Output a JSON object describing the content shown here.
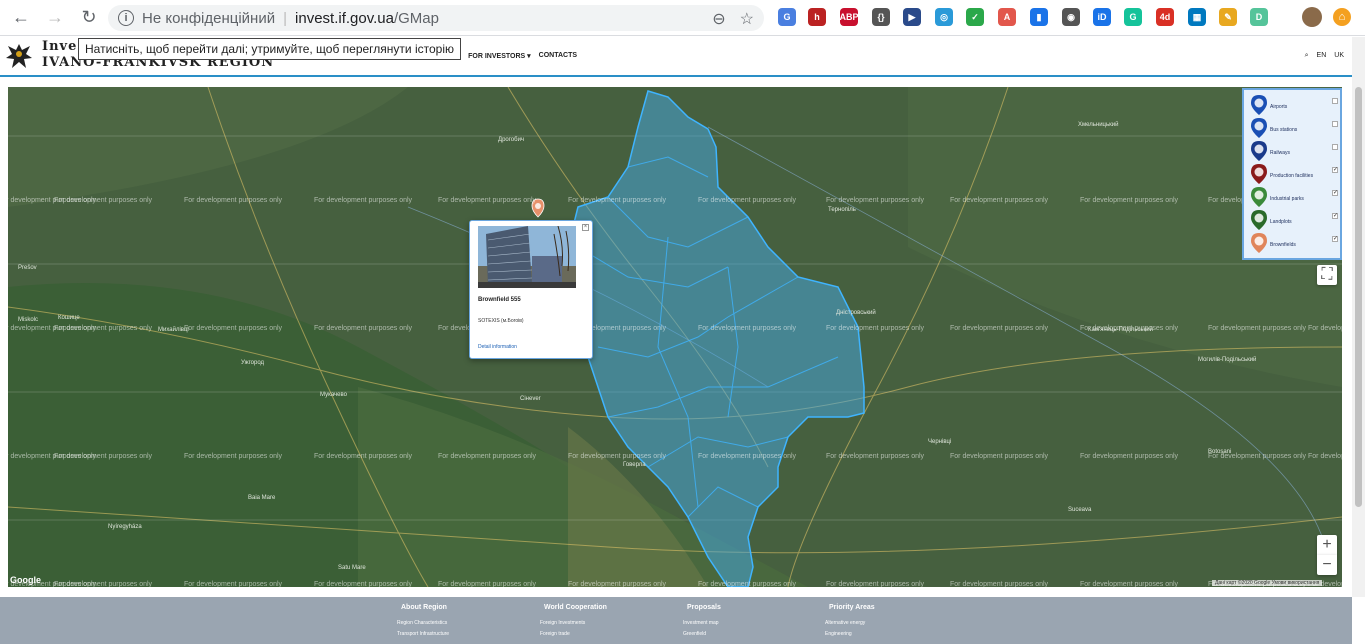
{
  "browser": {
    "security_label": "Не конфіденційний",
    "url_host": "invest.if.gov.ua",
    "url_path": "/GMap",
    "back_tooltip": "Натисніть, щоб перейти далі; утримуйте, щоб переглянути історію"
  },
  "extensions": [
    {
      "name": "translate-extension-icon",
      "text": "G",
      "color": "#4a7fe0"
    },
    {
      "name": "h-extension-icon",
      "text": "h",
      "color": "#b22"
    },
    {
      "name": "adblock-extension-icon",
      "text": "ABP",
      "color": "#c8102e"
    },
    {
      "name": "code-extension-icon",
      "text": "{}",
      "color": "#555"
    },
    {
      "name": "play-extension-icon",
      "text": "▶",
      "color": "#2a4a8a"
    },
    {
      "name": "compass-extension-icon",
      "text": "◎",
      "color": "#2a9ad8"
    },
    {
      "name": "shield-extension-icon",
      "text": "✓",
      "color": "#2ba84a"
    },
    {
      "name": "pdf-extension-icon",
      "text": "A",
      "color": "#e2574c"
    },
    {
      "name": "bookmark-extension-icon",
      "text": "▮",
      "color": "#1a73e8"
    },
    {
      "name": "lightbulb-extension-icon",
      "text": "◉",
      "color": "#555"
    },
    {
      "name": "id-extension-icon",
      "text": "iD",
      "color": "#1a73e8"
    },
    {
      "name": "grammarly-extension-icon",
      "text": "G",
      "color": "#15c39a"
    },
    {
      "name": "calendar-extension-icon",
      "text": "4d",
      "color": "#d93025"
    },
    {
      "name": "trello-extension-icon",
      "text": "▦",
      "color": "#0079bf"
    },
    {
      "name": "pencil-extension-icon",
      "text": "✎",
      "color": "#e8a820"
    },
    {
      "name": "d-extension-icon",
      "text": "D",
      "color": "#55c49a"
    }
  ],
  "site": {
    "title_line1": "Inves",
    "title_line2": "Ivano-Frankivsk region",
    "nav": [
      {
        "label": "S ▾"
      },
      {
        "label": "FOR INVESTORS ▾"
      },
      {
        "label": "CONTACTS"
      }
    ],
    "lang_en": "EN",
    "lang_uk": "UK"
  },
  "map": {
    "watermark": "For development purposes only",
    "legend": [
      {
        "label": "Airports",
        "checked": false,
        "color": "#1a4fb4",
        "icon": "airplane-icon"
      },
      {
        "label": "Bus stations",
        "checked": false,
        "color": "#1a4fb4",
        "icon": "bus-icon"
      },
      {
        "label": "Railways",
        "checked": false,
        "color": "#1a3a8a",
        "icon": "train-icon"
      },
      {
        "label": "Production facilities",
        "checked": true,
        "color": "#8a1a1a",
        "icon": "factory-icon"
      },
      {
        "label": "Industrial parks",
        "checked": true,
        "color": "#3a8a3a",
        "icon": "industrial-park-icon"
      },
      {
        "label": "Landplots",
        "checked": true,
        "color": "#2a6a2a",
        "icon": "landplot-icon"
      },
      {
        "label": "Brownfields",
        "checked": true,
        "color": "#e0855a",
        "icon": "brownfield-icon"
      }
    ],
    "infowindow": {
      "title": "Brownfield 555",
      "location": "SOTEXIS (м.Богоів)",
      "detail_link": "Detail information"
    },
    "attribution": "Дані карт ©2020 Google   Умови використання",
    "google_logo": "Google",
    "zoom_in": "+",
    "zoom_out": "−",
    "fullscreen": "⛶",
    "places": [
      {
        "name": "Мукачево"
      },
      {
        "name": "Ужгород"
      },
      {
        "name": "Кошице"
      },
      {
        "name": "Чернівці"
      },
      {
        "name": "Хмельницький"
      },
      {
        "name": "Тернопіль"
      },
      {
        "name": "Дністровський"
      },
      {
        "name": "Сінever"
      },
      {
        "name": "Говерла"
      },
      {
        "name": "Nyíregyháza"
      },
      {
        "name": "Satu Mare"
      },
      {
        "name": "Suceava"
      },
      {
        "name": "Botoşani"
      },
      {
        "name": "Baia Mare"
      },
      {
        "name": "Miskolc"
      },
      {
        "name": "Могилів-Подільський"
      },
      {
        "name": "Prešov"
      },
      {
        "name": "Михайлівці"
      },
      {
        "name": "Дрогобич"
      },
      {
        "name": "Кам'янець-Подільський"
      }
    ]
  },
  "footer": {
    "columns": [
      {
        "heading": "About Region",
        "links": [
          "Region Characteristics",
          "Transport Infrastructure"
        ]
      },
      {
        "heading": "World Cooperation",
        "links": [
          "Foreign Investments",
          "Foreign trade"
        ]
      },
      {
        "heading": "Proposals",
        "links": [
          "Investment map",
          "Greenfield"
        ]
      },
      {
        "heading": "Priority Areas",
        "links": [
          "Alternative energy",
          "Engineering"
        ]
      }
    ]
  }
}
